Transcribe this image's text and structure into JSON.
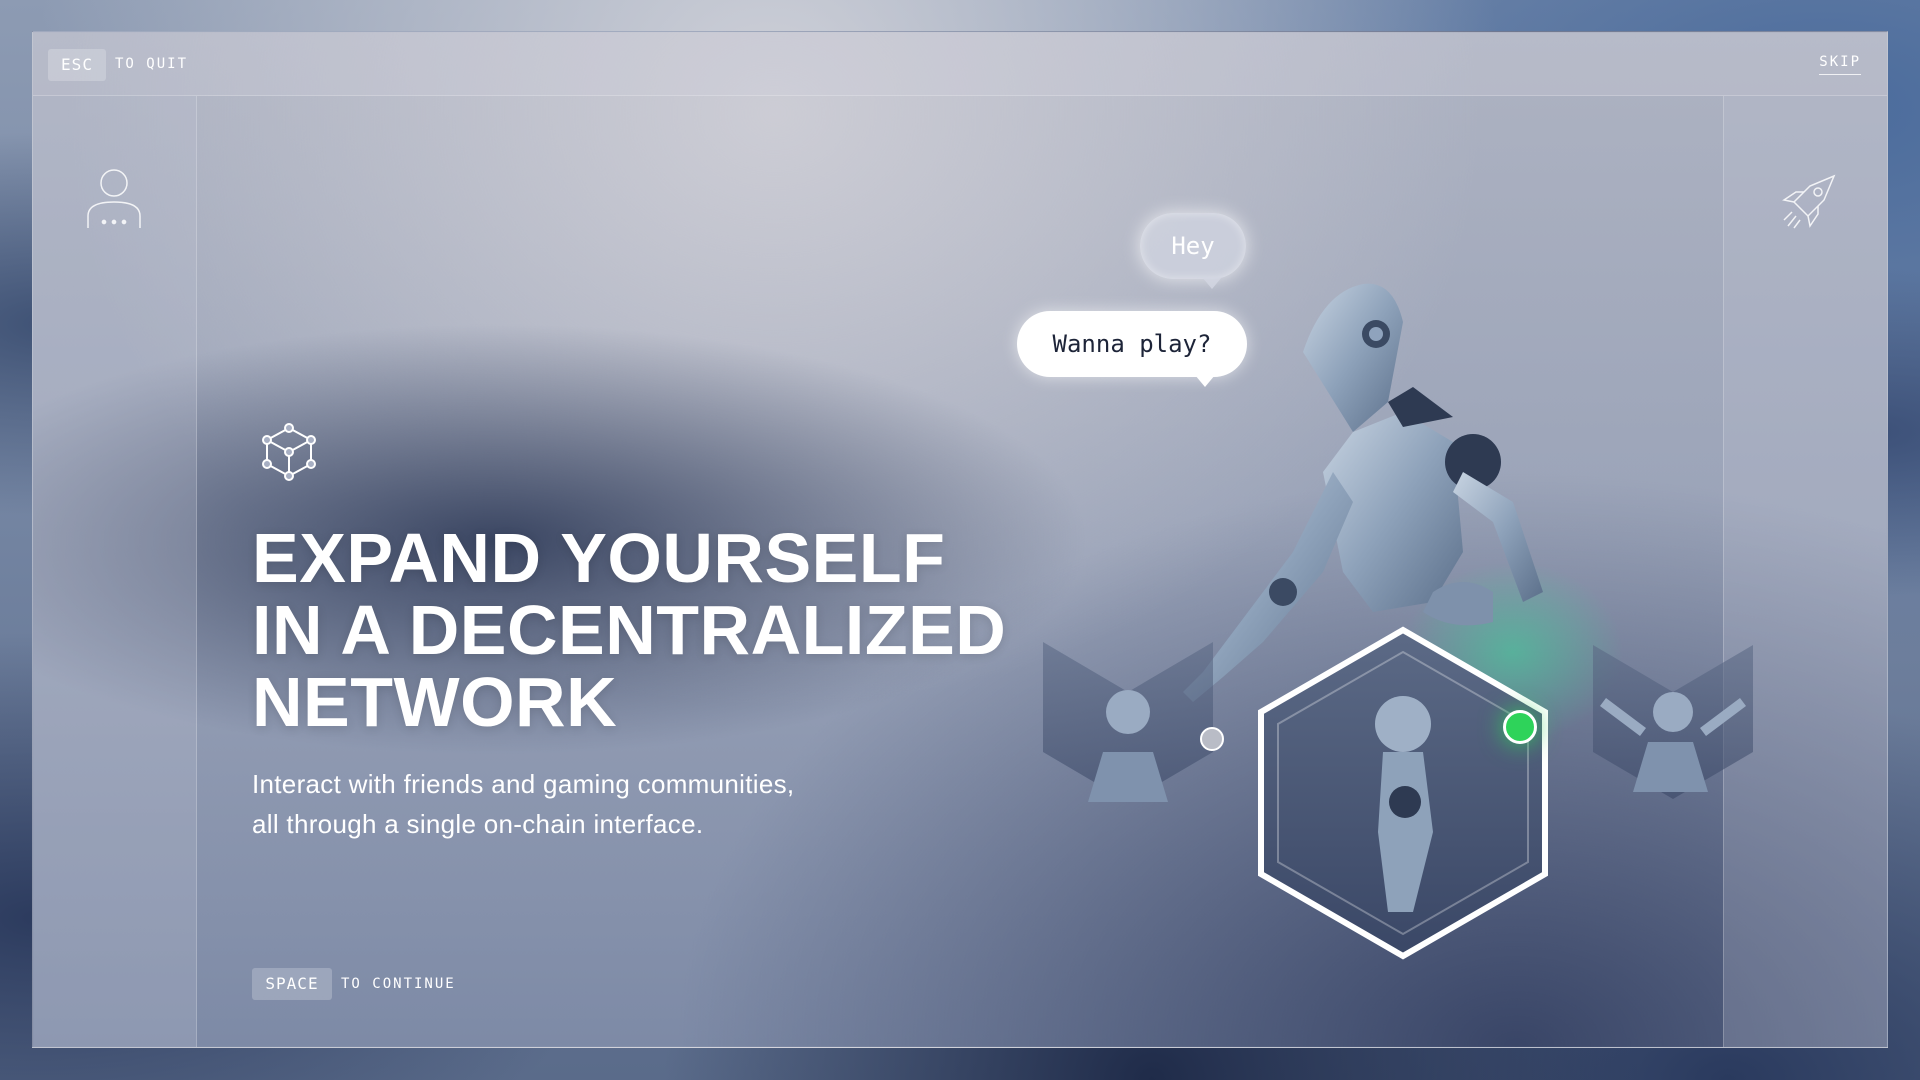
{
  "topbar": {
    "esc_key": "ESC",
    "esc_hint": "TO QUIT",
    "skip_label": "SKIP"
  },
  "sidebar_left": {
    "icon": "user-profile-icon"
  },
  "sidebar_right": {
    "icon": "rocket-icon"
  },
  "main": {
    "icon": "network-cube-icon",
    "headline": [
      "EXPAND YOURSELF",
      "IN A DECENTRALIZED",
      "NETWORK"
    ],
    "subtitle": [
      "Interact with friends and gaming communities,",
      "all through a single on-chain interface."
    ]
  },
  "footer": {
    "space_key": "SPACE",
    "space_hint": "TO CONTINUE"
  },
  "scene": {
    "bubbles": [
      "Hey",
      "Wanna play?"
    ],
    "avatars": [
      "avatar-left",
      "avatar-selected",
      "avatar-right"
    ],
    "selected_index": 1,
    "accent_color": "#2ed35a"
  }
}
